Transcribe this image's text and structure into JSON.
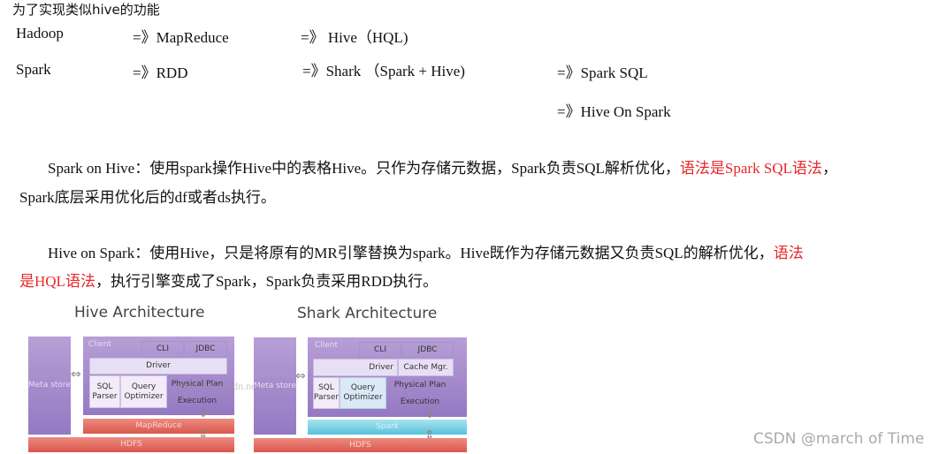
{
  "heading": "为了实现类似hive的功能",
  "rows": [
    {
      "a": "Hadoop",
      "b": "=》MapReduce",
      "c": "=》 Hive（HQL)"
    },
    {
      "a": "Spark",
      "b": "=》RDD",
      "c": "=》Shark （Spark + Hive)",
      "d": "=》Spark SQL",
      "e": "=》Hive On Spark"
    }
  ],
  "p1": {
    "text": "Spark on Hive：使用spark操作Hive中的表格Hive。只作为存储元数据，Spark负责SQL解析优化，",
    "red": "语法是Spark SQL语法",
    "tail": "，",
    "line2": "Spark底层采用优化后的df或者ds执行。"
  },
  "p2": {
    "text": "Hive  on  Spark：使用Hive，只是将原有的MR引擎替换为spark。Hive既作为存储元数据又负责SQL的解析优化，",
    "red1": "语法",
    "red2": "是HQL语法",
    "line2": "，执行引擎变成了Spark，Spark负责采用RDD执行。"
  },
  "hive": {
    "title": "Hive Architecture",
    "meta": "Meta store",
    "client": "Client",
    "cli": "CLI",
    "jdbc": "JDBC",
    "driver": "Driver",
    "sql": "SQL Parser",
    "qo": "Query Optimizer",
    "pp": "Physical Plan",
    "exec": "Execution",
    "engine": "MapReduce",
    "hdfs": "HDFS"
  },
  "shark": {
    "title": "Shark Architecture",
    "meta": "Meta store",
    "client": "Client",
    "cli": "CLI",
    "jdbc": "JDBC",
    "driver": "Driver",
    "cache": "Cache Mgr.",
    "sql": "SQL Parser",
    "qo": "Query Optimizer",
    "pp": "Physical Plan",
    "exec": "Execution",
    "engine": "Spark",
    "hdfs": "HDFS"
  },
  "image_watermark": "http://blog.csdn.net/",
  "watermark": "CSDN @march of Time"
}
